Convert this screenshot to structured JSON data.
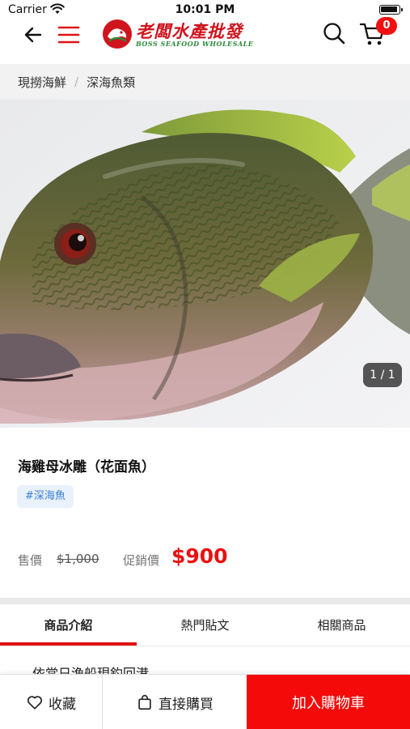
{
  "status_bar": {
    "carrier": "Carrier",
    "time": "10:01 PM"
  },
  "header": {
    "logo_cn": "老闆水產批發",
    "logo_en": "BOSS SEAFOOD WHOLESALE",
    "cart_count": "0",
    "icons": [
      "back-arrow-icon",
      "hamburger-menu-icon",
      "search-icon",
      "cart-icon"
    ],
    "accent_color": "#e01212"
  },
  "breadcrumb": {
    "items": [
      "現撈海鮮",
      "深海魚類"
    ],
    "separator": "/"
  },
  "gallery": {
    "counter": "1 / 1"
  },
  "product": {
    "title": "海雞母冰雕（花面魚）",
    "tag": "#深海魚",
    "price_label": "售價",
    "original_price": "$1,000",
    "promo_label": "促銷價",
    "promo_price": "$900",
    "promo_color": "#ea1010"
  },
  "tabs": [
    {
      "label": "商品介紹",
      "active": true
    },
    {
      "label": "熱門貼文",
      "active": false
    },
    {
      "label": "相關商品",
      "active": false
    }
  ],
  "description_preview": "依當日漁船現釣回港",
  "bottom_bar": {
    "favorite_label": "收藏",
    "buy_now_label": "直接購買",
    "add_to_cart_label": "加入購物車"
  }
}
